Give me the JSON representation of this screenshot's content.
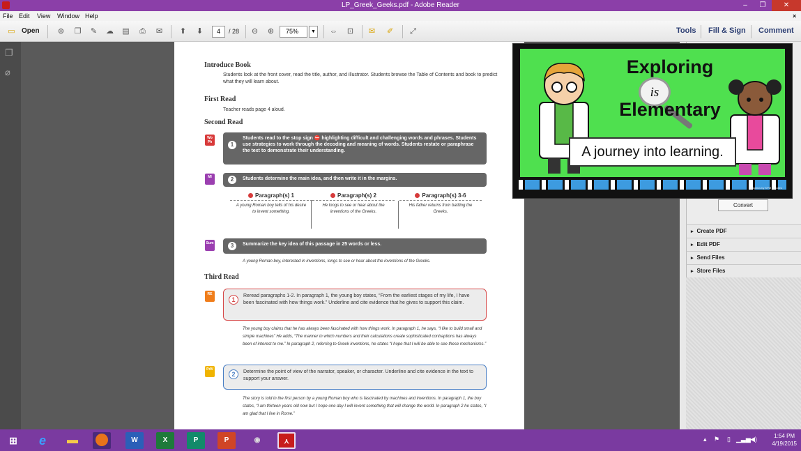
{
  "window": {
    "title": "LP_Greek_Geeks.pdf - Adobe Reader",
    "minimize": "–",
    "maximize": "❐",
    "close": "✕"
  },
  "menu": {
    "file": "File",
    "edit": "Edit",
    "view": "View",
    "window": "Window",
    "help": "Help",
    "close_doc": "×"
  },
  "toolbar": {
    "open": "Open",
    "page_current": "4",
    "page_total": "/ 28",
    "zoom": "75%",
    "tools": "Tools",
    "fill_sign": "Fill & Sign",
    "comment": "Comment"
  },
  "doc": {
    "introduce_heading": "Introduce Book",
    "introduce_text": "Students look at the front cover, read the title, author, and illustrator. Students browse the Table of Contents and book to predict what they will learn about.",
    "first_heading": "First Read",
    "first_text": "Teacher reads page 4 aloud.",
    "second_heading": "Second Read",
    "step1_badge": "Wo Ph",
    "step1_num": "1",
    "step1_text": "Students read to the stop sign ⛔ highlighting difficult and challenging words and phrases. Students use strategies to work through the decoding and meaning of words. Students restate or paraphrase the text to demonstrate their understanding.",
    "step2_badge": "MI",
    "step2_num": "2",
    "step2_text": "Students determine the main idea, and then write it in the margins.",
    "table": [
      {
        "head": "Paragraph(s) 1",
        "body": "A young Roman boy tells of his desire to invent something."
      },
      {
        "head": "Paragraph(s) 2",
        "body": "He longs to see or hear about the inventions of the Greeks."
      },
      {
        "head": "Paragraph(s) 3-6",
        "body": "His father returns from battling the Greeks."
      }
    ],
    "step3_badge": "Sum",
    "step3_num": "3",
    "step3_text": "Summarize the key idea of this passage in 25 words or less.",
    "step3_answer": "A young Roman boy, interested in inventions, longs to see or hear about the inventions of the Greeks.",
    "third_heading": "Third Read",
    "q1_badge": "RE",
    "q1_num": "1",
    "q1_text": "Reread paragraphs 1-2. In paragraph 1, the young boy states, “From the earliest stages of my life, I have been fascinated with how things work.” Underline and cite evidence that he gives to support this claim.",
    "q1_answer": "The young boy claims that he has always been fascinated with how things work. In paragraph 1, he says, “I like to build small and simple machines” He adds, “The manner in which numbers and their calculations create sophisticated contraptions has always been of interest to me.” In paragraph 2, referring to Greek inventions, he states “I hope that I will be able to see these mechanisms.”",
    "q2_badge": "PdV",
    "q2_num": "2",
    "q2_text": "Determine the point of view of the narrator, speaker, or character. Underline and cite evidence in the text to support your answer.",
    "q2_answer": "The story is told in the first person by a young Roman boy who is fascinated by machines and inventions. In paragraph 1, the boy states, “I am thirteen years old now but I hope one day I will invent something that will change the world. In paragraph 2 he states, “I am glad that I live in Rome.”"
  },
  "ad": {
    "line1": "Exploring",
    "is": "is",
    "line2": "Elementary",
    "banner": "A journey into learning.",
    "credit": "Graphics by KPM Doodles"
  },
  "rightpanel": {
    "convert": "Convert",
    "create_pdf": "Create PDF",
    "edit_pdf": "Edit PDF",
    "send_files": "Send Files",
    "store_files": "Store Files"
  },
  "taskbar": {
    "time": "1:54 PM",
    "date": "4/19/2015",
    "apps": [
      "Start",
      "Internet Explorer",
      "File Explorer",
      "Firefox",
      "Word",
      "Excel",
      "Publisher",
      "PowerPoint",
      "Game Controller",
      "Adobe Reader"
    ]
  },
  "colors": {
    "titlebar": "#8b3fa8",
    "taskbar": "#7a3aa0",
    "ad_green": "#4fe04f",
    "red_box": "#d64a4a",
    "blue_box": "#4a7fc4"
  }
}
